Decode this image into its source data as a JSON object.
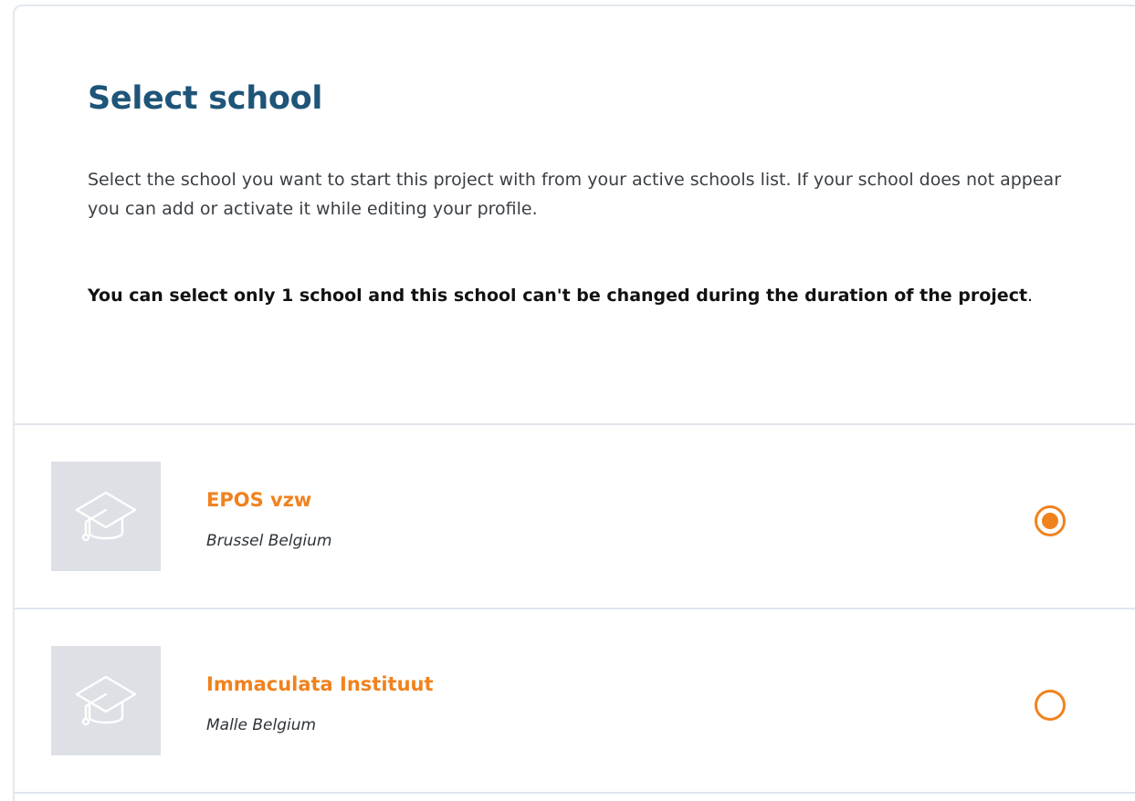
{
  "page": {
    "title": "Select school",
    "description": "Select the school you want to start this project with from your active schools list. If your school does not appear you can add or activate it while editing your profile.",
    "notice_bold": "You can select only 1 school and this school can't be changed during the duration of the project",
    "notice_tail": "."
  },
  "schools": [
    {
      "name": "EPOS vzw",
      "location": "Brussel Belgium",
      "icon": "graduation-cap-icon",
      "selected": true
    },
    {
      "name": "Immaculata Instituut",
      "location": "Malle Belgium",
      "icon": "graduation-cap-icon",
      "selected": false
    }
  ],
  "colors": {
    "title": "#1e5578",
    "accent": "#f0821e",
    "thumb_bg": "#dde1e5",
    "divider": "#dfe5ec"
  }
}
